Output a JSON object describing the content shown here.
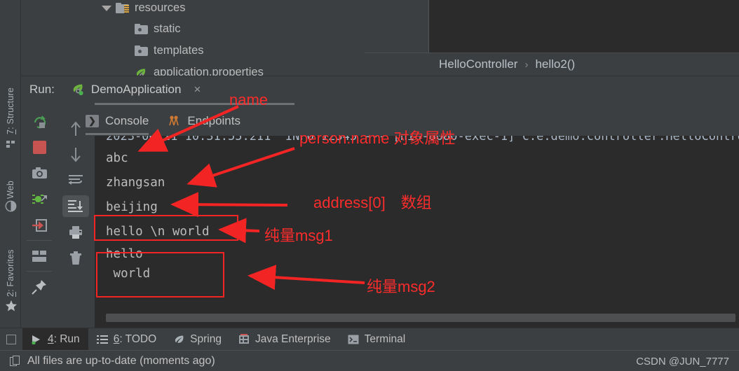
{
  "window": {
    "theme_bg": "#3c3f41",
    "console_bg": "#2b2b2b",
    "accent_red": "#f32424",
    "text_color": "#bbbbbb"
  },
  "project_tree": {
    "items": [
      {
        "label": "resources",
        "icon": "folder-resources-icon",
        "indent": 92,
        "expanded": true
      },
      {
        "label": "static",
        "icon": "folder-icon",
        "indent": 138,
        "expanded": false
      },
      {
        "label": "templates",
        "icon": "folder-icon",
        "indent": 138,
        "expanded": false
      },
      {
        "label": "application.properties",
        "icon": "spring-leaf-icon",
        "indent": 138,
        "expanded": false
      }
    ]
  },
  "editor": {
    "breadcrumb": {
      "class_name": "HelloController",
      "separator": "›",
      "method_name": "hello2()"
    }
  },
  "run_panel": {
    "run_label": "Run:",
    "configuration": {
      "name": "DemoApplication",
      "icon": "spring-boot-run-icon",
      "close_label": "×"
    },
    "tabs": [
      {
        "label": "Console",
        "icon": "console-icon",
        "active": true
      },
      {
        "label": "Endpoints",
        "icon": "endpoints-icon",
        "active": false
      }
    ],
    "toolbar_left": [
      {
        "name": "rerun-button",
        "tooltip": "Rerun"
      },
      {
        "name": "stop-button",
        "tooltip": "Stop"
      },
      {
        "name": "screenshot-button",
        "tooltip": "Camera"
      },
      {
        "name": "thread-dump-button",
        "tooltip": "Dump Threads"
      },
      {
        "name": "exit-button",
        "tooltip": "Exit"
      },
      {
        "name": "layout-button",
        "tooltip": "Layout Settings"
      },
      {
        "name": "pin-button",
        "tooltip": "Pin Tab"
      }
    ],
    "toolbar_console": [
      {
        "name": "scroll-up-button",
        "tooltip": "Up the stack trace"
      },
      {
        "name": "scroll-down-button",
        "tooltip": "Down the stack trace"
      },
      {
        "name": "soft-wrap-button",
        "tooltip": "Use Soft Wraps"
      },
      {
        "name": "scroll-to-end-button",
        "tooltip": "Scroll to the end",
        "selected": true
      },
      {
        "name": "print-button",
        "tooltip": "Print"
      },
      {
        "name": "clear-all-button",
        "tooltip": "Clear All"
      }
    ]
  },
  "console_output": {
    "lines": [
      {
        "text": "abc",
        "boxed": false
      },
      {
        "text": "zhangsan",
        "boxed": false
      },
      {
        "text": "beijing",
        "boxed": false
      },
      {
        "text": "hello \\n world",
        "boxed": true
      },
      {
        "text": "hello",
        "boxed": false
      },
      {
        "text": " world",
        "boxed": true
      }
    ]
  },
  "annotations": [
    {
      "id": "anno-name",
      "text": "name"
    },
    {
      "id": "anno-person-name",
      "text": "person.name 对象属性"
    },
    {
      "id": "anno-address",
      "text": "address[0]　数组"
    },
    {
      "id": "anno-msg1",
      "text": "纯量msg1"
    },
    {
      "id": "anno-msg2",
      "text": "纯量msg2"
    }
  ],
  "left_sidebar": {
    "tabs": [
      {
        "label_prefix": "7",
        "label": ": Structure",
        "icon": "structure-icon"
      },
      {
        "label_prefix": "",
        "label": "Web",
        "icon": "web-globe-icon"
      },
      {
        "label_prefix": "2",
        "label": ": Favorites",
        "icon": "star-icon"
      }
    ]
  },
  "bottom_bar": {
    "tabs": [
      {
        "num": "4",
        "label": ": Run",
        "icon": "run-arrow-icon",
        "active": true
      },
      {
        "num": "6",
        "label": ": TODO",
        "icon": "todo-list-icon",
        "active": false
      },
      {
        "num": "",
        "label": "Spring",
        "icon": "spring-leaf-icon",
        "active": false
      },
      {
        "num": "",
        "label": "Java Enterprise",
        "icon": "java-enterprise-icon",
        "active": false
      },
      {
        "num": "",
        "label": "Terminal",
        "icon": "terminal-icon",
        "active": false
      }
    ]
  },
  "status_bar": {
    "message": "All files are up-to-date (moments ago)",
    "icon": "file-sync-icon",
    "watermark": "CSDN @JUN_7777"
  }
}
